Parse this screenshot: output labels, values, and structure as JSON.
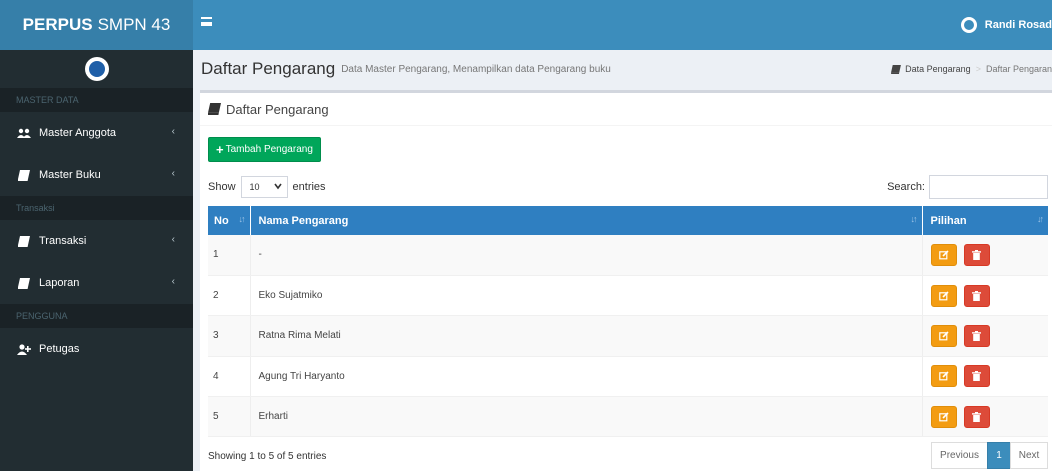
{
  "app": {
    "logo_bold": "PERPUS",
    "logo_rest": "SMPN 43",
    "user_name": "Randi Rosad"
  },
  "sidebar": {
    "headers": [
      "MASTER DATA",
      "Transaksi",
      "PENGGUNA"
    ],
    "items": [
      {
        "label": "Master Anggota",
        "icon": "users-icon"
      },
      {
        "label": "Master Buku",
        "icon": "book-icon"
      },
      {
        "label": "Transaksi",
        "icon": "book-icon"
      },
      {
        "label": "Laporan",
        "icon": "book-icon"
      },
      {
        "label": "Petugas",
        "icon": "user-plus-icon"
      }
    ],
    "chevron": "‹"
  },
  "page": {
    "title": "Daftar Pengarang",
    "subtitle": "Data Master Pengarang, Menampilkan data Pengarang buku",
    "breadcrumb": [
      "Data Pengarang",
      "Daftar Pengaran"
    ],
    "breadcrumb_sep": ">"
  },
  "box": {
    "title": "Daftar Pengarang",
    "add_button": "Tambah Pengarang",
    "add_plus": "+",
    "show_label": "Show",
    "entries_label": "entries",
    "entries_value": "10",
    "search_label": "Search:",
    "search_value": ""
  },
  "table": {
    "columns": [
      "No",
      "Nama Pengarang",
      "Pilihan"
    ],
    "rows": [
      {
        "no": "1",
        "name": "-"
      },
      {
        "no": "2",
        "name": "Eko Sujatmiko"
      },
      {
        "no": "3",
        "name": "Ratna Rima Melati"
      },
      {
        "no": "4",
        "name": "Agung Tri Haryanto"
      },
      {
        "no": "5",
        "name": "Erharti"
      }
    ]
  },
  "footer": {
    "info": "Showing 1 to 5 of 5 entries",
    "prev": "Previous",
    "page": "1",
    "next": "Next"
  },
  "colors": {
    "navbar": "#3c8dbc",
    "sidebar": "#222d32",
    "table_header": "#2f7fc1",
    "add": "#00a65a",
    "edit": "#f39c12",
    "delete": "#dd4b39"
  }
}
